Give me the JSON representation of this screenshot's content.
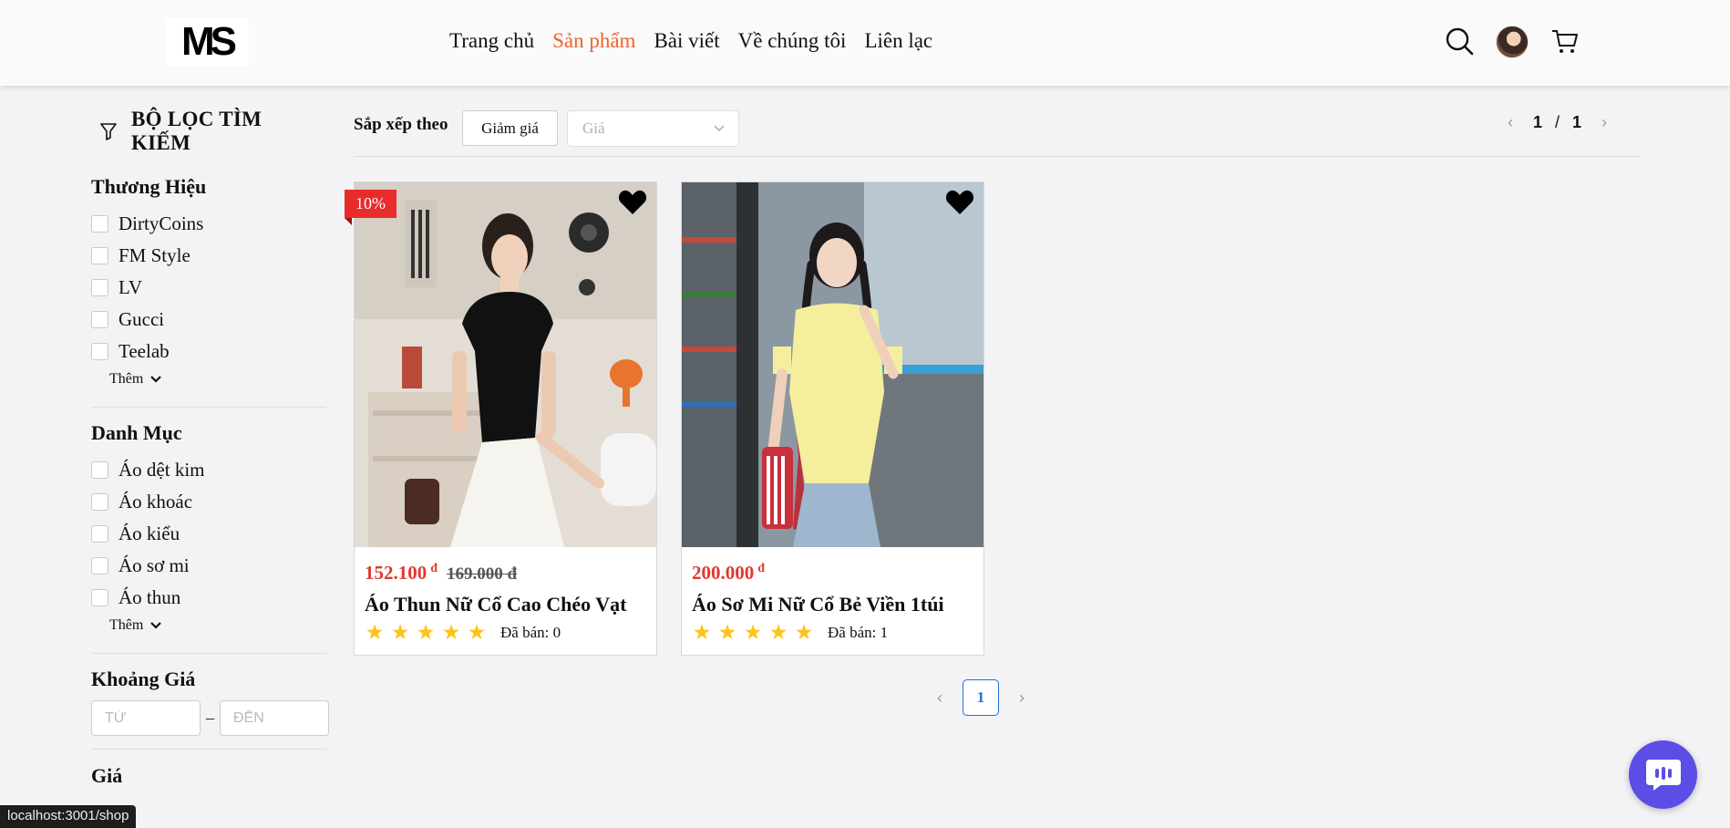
{
  "header": {
    "logo_text": "MS",
    "nav": [
      {
        "label": "Trang chủ",
        "active": false
      },
      {
        "label": "Sản phẩm",
        "active": true
      },
      {
        "label": "Bài viết",
        "active": false
      },
      {
        "label": "Về chúng tôi",
        "active": false
      },
      {
        "label": "Liên lạc",
        "active": false
      }
    ],
    "icons": [
      "search-icon",
      "avatar",
      "cart-icon"
    ],
    "accent_color": "#f0622b"
  },
  "sidebar": {
    "filter_title": "BỘ LỌC TÌM KIẾM",
    "brand": {
      "title": "Thương Hiệu",
      "options": [
        "DirtyCoins",
        "FM Style",
        "LV",
        "Gucci",
        "Teelab"
      ],
      "more_label": "Thêm"
    },
    "category": {
      "title": "Danh Mục",
      "options": [
        "Áo dệt kim",
        "Áo khoác",
        "Áo kiểu",
        "Áo sơ mi",
        "Áo thun"
      ],
      "more_label": "Thêm"
    },
    "price_range": {
      "title": "Khoảng Giá",
      "from_placeholder": "TỪ",
      "separator": "–",
      "to_placeholder": "ĐẾN"
    },
    "next_section_partial": "Giá"
  },
  "sort": {
    "label": "Sắp xếp theo",
    "discount_button": "Giảm giá",
    "price_select_placeholder": "Giá"
  },
  "pager_top": {
    "current": "1",
    "separator": "/",
    "total": "1"
  },
  "products": [
    {
      "discount_badge": "10%",
      "price": "152.100",
      "currency": "đ",
      "old_price": "169.000 đ",
      "name": "Áo Thun Nữ Cổ Cao Chéo Vạt",
      "rating": 5,
      "sold": "Đã bán: 0"
    },
    {
      "discount_badge": "",
      "price": "200.000",
      "currency": "đ",
      "old_price": "",
      "name": "Áo Sơ Mi Nữ Cổ Bẻ Viền 1túi",
      "rating": 5,
      "sold": "Đã bán: 1"
    }
  ],
  "pager_bottom": {
    "current": "1"
  },
  "status_url": "localhost:3001/shop",
  "colors": {
    "price_red": "#e0392d",
    "star": "#fcc419",
    "badge": "#e82c2c",
    "chat": "#5b4de6",
    "page_active": "#1e6fd9"
  }
}
